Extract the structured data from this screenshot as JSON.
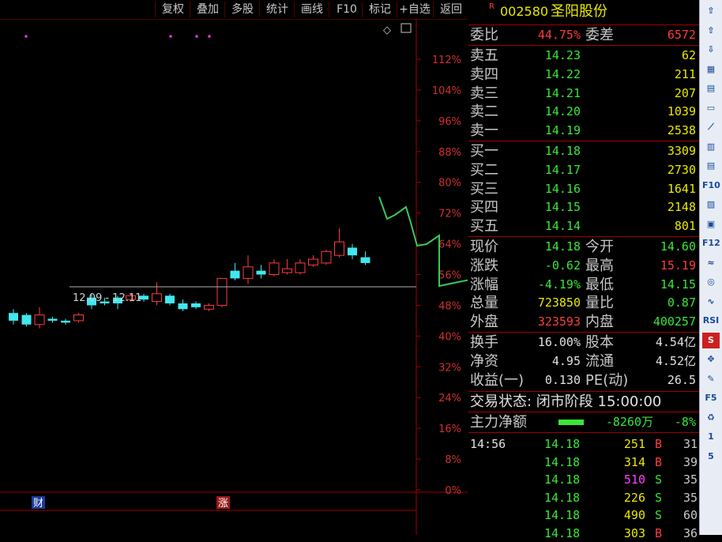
{
  "menu": [
    "复权",
    "叠加",
    "多股",
    "统计",
    "画线",
    "F10",
    "标记",
    "+自选",
    "返回"
  ],
  "chart": {
    "y_labels": [
      "112%",
      "104%",
      "96%",
      "88%",
      "80%",
      "72%",
      "64%",
      "56%",
      "48%",
      "40%",
      "32%",
      "24%",
      "16%",
      "8%",
      "0%"
    ],
    "range_label": "12.09 - 12.11",
    "markers": [
      "财",
      "涨"
    ],
    "candles": [
      {
        "o": 0.46,
        "c": 0.44,
        "h": 0.47,
        "l": 0.43
      },
      {
        "o": 0.455,
        "c": 0.43,
        "h": 0.46,
        "l": 0.425
      },
      {
        "o": 0.43,
        "c": 0.455,
        "h": 0.475,
        "l": 0.42
      },
      {
        "o": 0.445,
        "c": 0.44,
        "h": 0.45,
        "l": 0.435
      },
      {
        "o": 0.44,
        "c": 0.435,
        "h": 0.445,
        "l": 0.43
      },
      {
        "o": 0.44,
        "c": 0.455,
        "h": 0.46,
        "l": 0.435
      },
      {
        "o": 0.5,
        "c": 0.48,
        "h": 0.51,
        "l": 0.47
      },
      {
        "o": 0.49,
        "c": 0.485,
        "h": 0.5,
        "l": 0.48
      },
      {
        "o": 0.5,
        "c": 0.485,
        "h": 0.505,
        "l": 0.47
      },
      {
        "o": 0.495,
        "c": 0.505,
        "h": 0.51,
        "l": 0.49
      },
      {
        "o": 0.505,
        "c": 0.495,
        "h": 0.51,
        "l": 0.49
      },
      {
        "o": 0.49,
        "c": 0.51,
        "h": 0.54,
        "l": 0.48
      },
      {
        "o": 0.505,
        "c": 0.485,
        "h": 0.51,
        "l": 0.48
      },
      {
        "o": 0.485,
        "c": 0.47,
        "h": 0.495,
        "l": 0.465
      },
      {
        "o": 0.485,
        "c": 0.475,
        "h": 0.49,
        "l": 0.47
      },
      {
        "o": 0.47,
        "c": 0.48,
        "h": 0.485,
        "l": 0.465
      },
      {
        "o": 0.48,
        "c": 0.55,
        "h": 0.55,
        "l": 0.475
      },
      {
        "o": 0.57,
        "c": 0.55,
        "h": 0.59,
        "l": 0.545
      },
      {
        "o": 0.55,
        "c": 0.58,
        "h": 0.61,
        "l": 0.535
      },
      {
        "o": 0.57,
        "c": 0.56,
        "h": 0.585,
        "l": 0.55
      },
      {
        "o": 0.56,
        "c": 0.59,
        "h": 0.6,
        "l": 0.555
      },
      {
        "o": 0.565,
        "c": 0.575,
        "h": 0.6,
        "l": 0.56
      },
      {
        "o": 0.565,
        "c": 0.59,
        "h": 0.6,
        "l": 0.56
      },
      {
        "o": 0.585,
        "c": 0.6,
        "h": 0.61,
        "l": 0.58
      },
      {
        "o": 0.59,
        "c": 0.62,
        "h": 0.625,
        "l": 0.585
      },
      {
        "o": 0.61,
        "c": 0.645,
        "h": 0.68,
        "l": 0.605
      },
      {
        "o": 0.63,
        "c": 0.61,
        "h": 0.64,
        "l": 0.6
      },
      {
        "o": 0.605,
        "c": 0.59,
        "h": 0.62,
        "l": 0.585
      }
    ]
  },
  "stock": {
    "code": "002580",
    "name": "圣阳股份",
    "badge": "R"
  },
  "weibi": {
    "label": "委比",
    "value": "44.75%",
    "label2": "委差",
    "value2": "6572"
  },
  "asks": [
    {
      "label": "卖五",
      "price": "14.23",
      "vol": "62"
    },
    {
      "label": "卖四",
      "price": "14.22",
      "vol": "211"
    },
    {
      "label": "卖三",
      "price": "14.21",
      "vol": "207"
    },
    {
      "label": "卖二",
      "price": "14.20",
      "vol": "1039"
    },
    {
      "label": "卖一",
      "price": "14.19",
      "vol": "2538"
    }
  ],
  "bids": [
    {
      "label": "买一",
      "price": "14.18",
      "vol": "3309"
    },
    {
      "label": "买二",
      "price": "14.17",
      "vol": "2730"
    },
    {
      "label": "买三",
      "price": "14.16",
      "vol": "1641"
    },
    {
      "label": "买四",
      "price": "14.15",
      "vol": "2148"
    },
    {
      "label": "买五",
      "price": "14.14",
      "vol": "801"
    }
  ],
  "quote": [
    {
      "l1": "现价",
      "v1": "14.18",
      "c1": "g",
      "l2": "今开",
      "v2": "14.60",
      "c2": "g"
    },
    {
      "l1": "涨跌",
      "v1": "-0.62",
      "c1": "g",
      "l2": "最高",
      "v2": "15.19",
      "c2": "r"
    },
    {
      "l1": "涨幅",
      "v1": "-4.19%",
      "c1": "g",
      "l2": "最低",
      "v2": "14.15",
      "c2": "g"
    },
    {
      "l1": "总量",
      "v1": "723850",
      "c1": "y",
      "l2": "量比",
      "v2": "0.87",
      "c2": "g"
    },
    {
      "l1": "外盘",
      "v1": "323593",
      "c1": "r",
      "l2": "内盘",
      "v2": "400257",
      "c2": "g"
    }
  ],
  "fund": [
    {
      "l1": "换手",
      "v1": "16.00%",
      "l2": "股本",
      "v2": "4.54亿"
    },
    {
      "l1": "净资",
      "v1": "4.95",
      "l2": "流通",
      "v2": "4.52亿"
    },
    {
      "l1": "收益(一)",
      "v1": "0.130",
      "l2": "PE(动)",
      "v2": "26.5"
    }
  ],
  "status": "交易状态: 闭市阶段 15:00:00",
  "main_flow": {
    "label": "主力净额",
    "value": "-8260万",
    "pct": "-8%"
  },
  "ticks": [
    {
      "time": "14:56",
      "price": "14.18",
      "vol": "251",
      "side": "B",
      "n": "31",
      "vc": "y"
    },
    {
      "time": "",
      "price": "14.18",
      "vol": "314",
      "side": "B",
      "n": "39",
      "vc": "y"
    },
    {
      "time": "",
      "price": "14.18",
      "vol": "510",
      "side": "S",
      "n": "35",
      "vc": "m"
    },
    {
      "time": "",
      "price": "14.18",
      "vol": "226",
      "side": "S",
      "n": "35",
      "vc": "y"
    },
    {
      "time": "",
      "price": "14.18",
      "vol": "490",
      "side": "S",
      "n": "60",
      "vc": "y"
    },
    {
      "time": "",
      "price": "14.18",
      "vol": "303",
      "side": "B",
      "n": "36",
      "vc": "y"
    }
  ],
  "toolbar": [
    "up-arrow-icon",
    "outline-up-icon",
    "outline-down-icon",
    "chart-icon",
    "grid-icon",
    "blank-icon",
    "line-icon",
    "candle-icon",
    "report-icon",
    "F10",
    "book-icon",
    "self-icon",
    "F12",
    "waves-icon",
    "circle-icon",
    "graph-icon",
    "RSI",
    "S",
    "move-icon",
    "pen-icon",
    "F5",
    "cycle-icon",
    "1",
    "5"
  ]
}
